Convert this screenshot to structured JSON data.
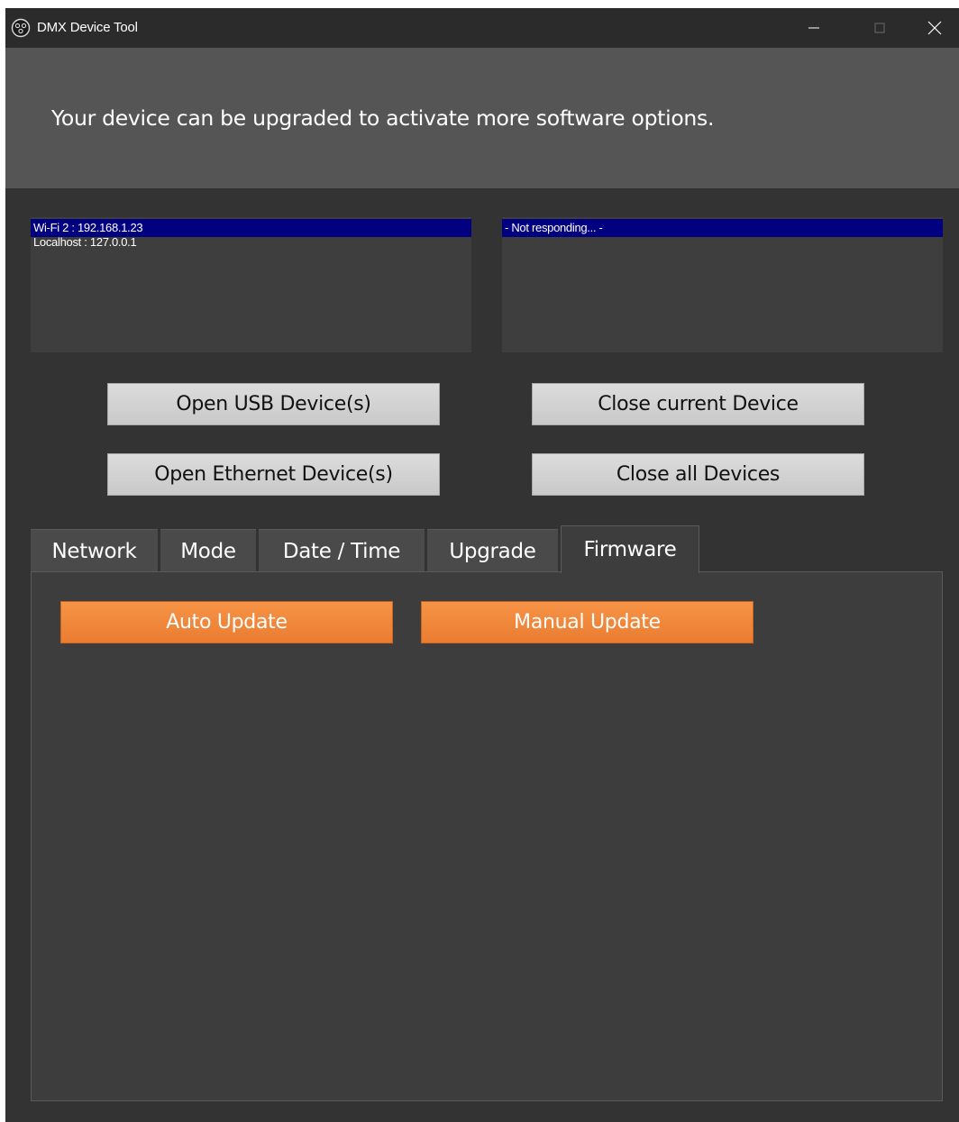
{
  "window": {
    "title": "DMX Device Tool",
    "app_icon": "dmx-app-icon"
  },
  "banner": {
    "text": "Your device can be upgraded to activate more software options."
  },
  "interfaces_list": {
    "items": [
      "Wi-Fi 2 : 192.168.1.23",
      "Localhost : 127.0.0.1"
    ],
    "selected_index": 0
  },
  "devices_list": {
    "items": [
      "- Not responding... -"
    ],
    "selected_index": 0
  },
  "buttons": {
    "open_usb": "Open USB Device(s)",
    "close_current": "Close current Device",
    "open_ethernet": "Open Ethernet Device(s)",
    "close_all": "Close all Devices"
  },
  "tabs": {
    "items": [
      "Network",
      "Mode",
      "Date / Time",
      "Upgrade",
      "Firmware"
    ],
    "active": "Firmware"
  },
  "firmware_panel": {
    "auto_update": "Auto Update",
    "manual_update": "Manual Update"
  },
  "colors": {
    "background": "#333333",
    "banner": "#555555",
    "selection": "#000080",
    "accent_orange": "#f28a3e"
  }
}
